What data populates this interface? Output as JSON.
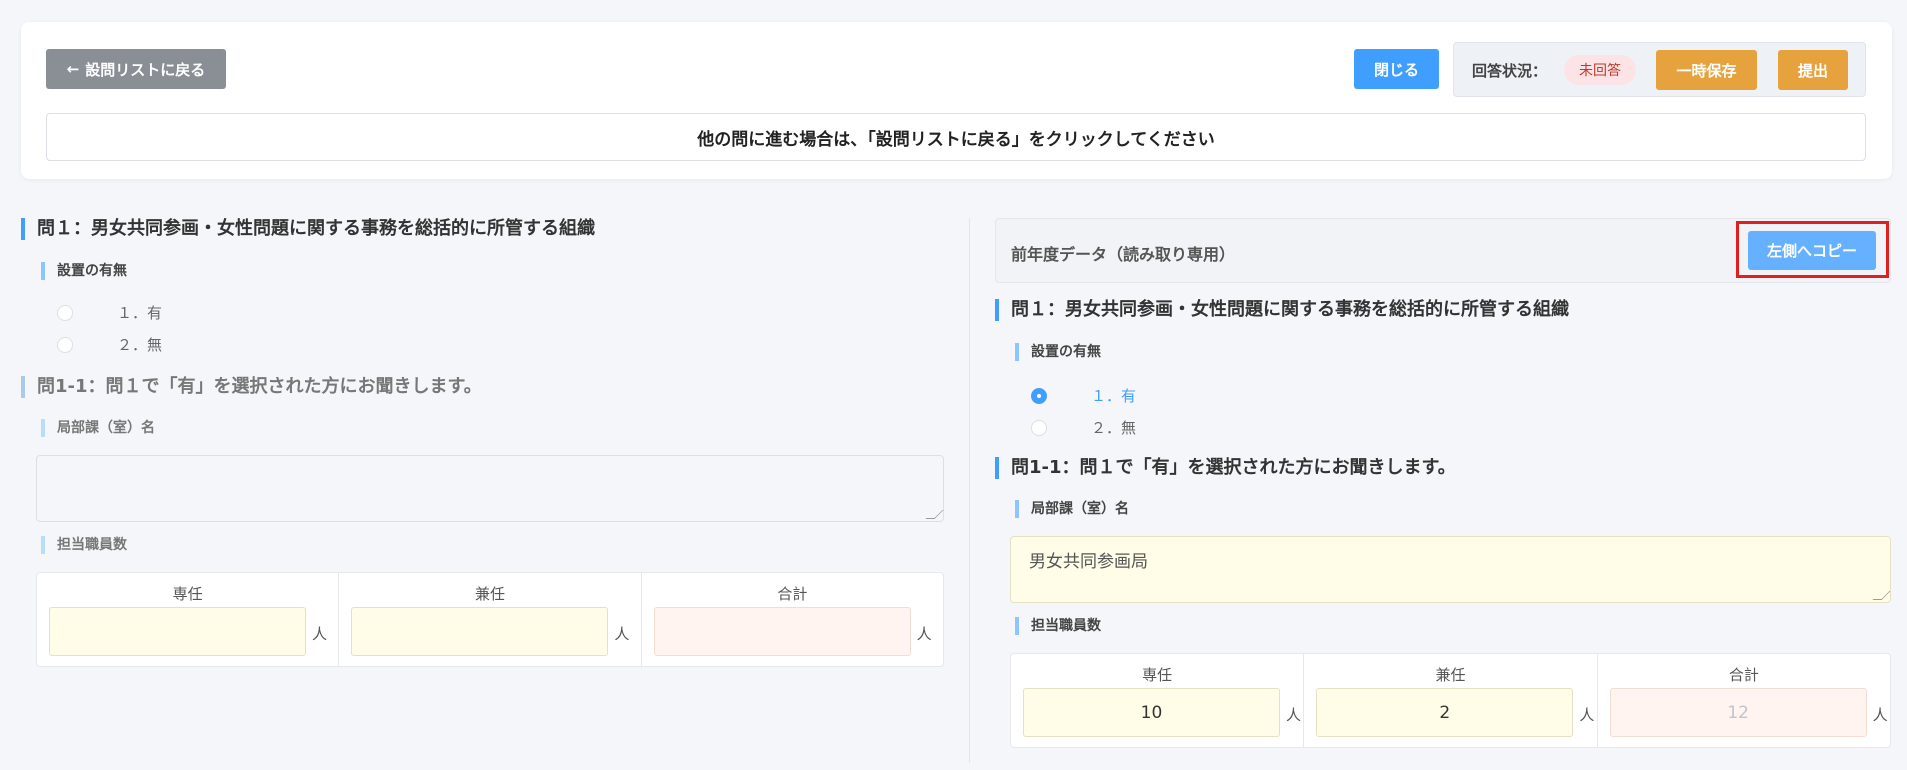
{
  "header": {
    "back_label": "設問リストに戻る",
    "close_label": "閉じる",
    "status_label": "回答状況：",
    "status_value": "未回答",
    "save_label": "一時保存",
    "submit_label": "提出",
    "notice": "他の問に進む場合は、「設問リストに戻る」をクリックしてください"
  },
  "left": {
    "q1_title": "問１：男女共同参画・女性問題に関する事務を総括的に所管する組織",
    "setup_label": "設置の有無",
    "options": [
      "１．有",
      "２．無"
    ],
    "q1_1_title": "問1-1：問１で「有」を選択された方にお聞きします。",
    "dept_label": "局部課（室）名",
    "dept_value": "",
    "staff_label": "担当職員数",
    "staff_columns": [
      "専任",
      "兼任",
      "合計"
    ],
    "staff_values": [
      "",
      "",
      ""
    ],
    "unit": "人"
  },
  "right": {
    "prev_title": "前年度データ（読み取り専用）",
    "copy_label": "左側へコピー",
    "q1_title": "問１：男女共同参画・女性問題に関する事務を総括的に所管する組織",
    "setup_label": "設置の有無",
    "options": [
      "１．有",
      "２．無"
    ],
    "selected_option": "１．有",
    "q1_1_title": "問1-1：問１で「有」を選択された方にお聞きします。",
    "dept_label": "局部課（室）名",
    "dept_value": "男女共同参画局",
    "staff_label": "担当職員数",
    "staff_columns": [
      "専任",
      "兼任",
      "合計"
    ],
    "staff_values": [
      "10",
      "2",
      "12"
    ],
    "unit": "人"
  },
  "colors": {
    "primary": "#409eff",
    "warning": "#e6a23c",
    "back": "#8a8f95",
    "highlight": "#e02020"
  }
}
